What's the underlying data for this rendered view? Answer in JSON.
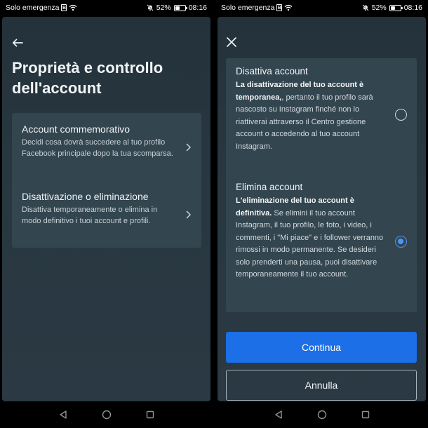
{
  "status_bar": {
    "carrier": "Solo emergenza",
    "sim_label": "B",
    "battery": "52%",
    "battery_level": 0.52,
    "time": "08:16"
  },
  "left_screen": {
    "title": "Proprietà e controllo dell'account",
    "options": [
      {
        "title": "Account commemorativo",
        "description": "Decidi cosa dovrà succedere al tuo profilo Facebook principale dopo la tua scomparsa."
      },
      {
        "title": "Disattivazione o eliminazione",
        "description": "Disattiva temporaneamente o elimina in modo definitivo i tuoi account e profili."
      }
    ]
  },
  "right_screen": {
    "deactivate": {
      "title": "Disattiva account",
      "desc_bold": "La disattivazione del tuo account è temporanea,",
      "desc_rest": ", pertanto il tuo profilo sarà nascosto su Instagram finché non lo riattiverai attraverso il Centro gestione account o accedendo al tuo account Instagram.",
      "selected": false
    },
    "delete": {
      "title": "Elimina account",
      "desc_bold": "L'eliminazione del tuo account è definitiva.",
      "desc_rest": " Se elimini il tuo account Instagram, il tuo profilo, le foto, i video, i commenti, i \"Mi piace\" e i follower verranno rimossi in modo permanente. Se desideri solo prenderti una pausa, puoi disattivare temporaneamente il tuo account.",
      "selected": true
    },
    "continue_label": "Continua",
    "cancel_label": "Annulla"
  },
  "icons": {
    "back": "arrow-left-icon",
    "close": "close-icon",
    "chevron": "chevron-right-icon",
    "nav_back": "triangle-back-icon",
    "nav_home": "circle-home-icon",
    "nav_recents": "square-recents-icon"
  },
  "colors": {
    "background": "#2a3943",
    "card": "#334650",
    "accent": "#1c6fe6",
    "radio_selected": "#4c94f5"
  }
}
